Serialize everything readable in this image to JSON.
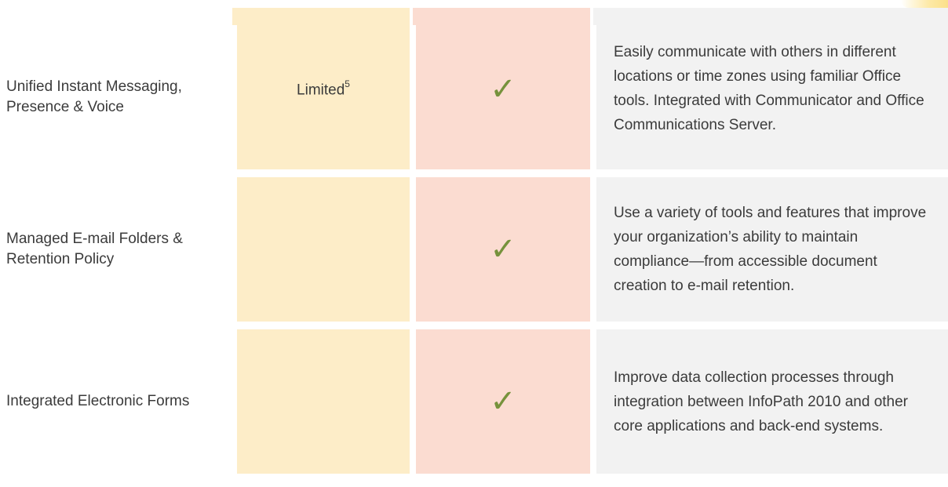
{
  "rows": [
    {
      "feature": "Unified Instant Messaging, Presence & Voice",
      "standard_value": "Limited",
      "standard_footnote": "5",
      "professional_icon": "check-icon",
      "professional_glyph": "✓",
      "description": "Easily communicate with others in different locations or time zones using familiar Office tools. Integrated with Communicator and Office Communications Server."
    },
    {
      "feature": "Managed E-mail Folders & Retention Policy",
      "standard_value": "",
      "professional_icon": "check-icon",
      "professional_glyph": "✓",
      "description": "Use a variety of tools and features that improve your organization’s ability to maintain compliance—from accessible document creation to e-mail retention."
    },
    {
      "feature": "Integrated Electronic Forms",
      "standard_value": "",
      "professional_icon": "check-icon",
      "professional_glyph": "✓",
      "description": "Improve data collection processes through integration between InfoPath 2010 and other core applications and back-end systems."
    }
  ],
  "colors": {
    "standard_column": "#fdedc8",
    "professional_column": "#fbdcd1",
    "description_column": "#f2f2f2",
    "check": "#76923c",
    "text": "#3b3b3b"
  }
}
